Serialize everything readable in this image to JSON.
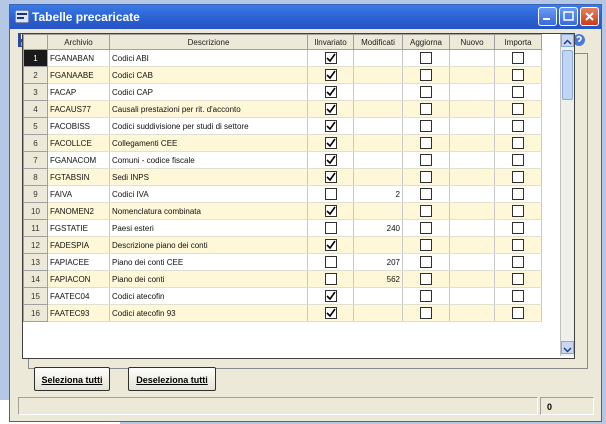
{
  "window": {
    "title": "Tabelle precaricate"
  },
  "columns": [
    "",
    "Archivio",
    "Descrizione",
    "Ilnvariato",
    "Modificati",
    "Aggiorna",
    "Nuovo",
    "Importa"
  ],
  "rows": [
    {
      "n": "1",
      "archivio": "FGANABAN",
      "descrizione": "Codici ABI",
      "invariato": true,
      "modificati": "",
      "aggiorna": false,
      "nuovo": "",
      "importa": false
    },
    {
      "n": "2",
      "archivio": "FGANAABE",
      "descrizione": "Codici CAB",
      "invariato": true,
      "modificati": "",
      "aggiorna": false,
      "nuovo": "",
      "importa": false
    },
    {
      "n": "3",
      "archivio": "FACAP",
      "descrizione": "Codici CAP",
      "invariato": true,
      "modificati": "",
      "aggiorna": false,
      "nuovo": "",
      "importa": false
    },
    {
      "n": "4",
      "archivio": "FACAUS77",
      "descrizione": "Causali prestazioni per rit. d'acconto",
      "invariato": true,
      "modificati": "",
      "aggiorna": false,
      "nuovo": "",
      "importa": false
    },
    {
      "n": "5",
      "archivio": "FACOBISS",
      "descrizione": "Codici suddivisione per studi di settore",
      "invariato": true,
      "modificati": "",
      "aggiorna": false,
      "nuovo": "",
      "importa": false
    },
    {
      "n": "6",
      "archivio": "FACOLLCE",
      "descrizione": "Collegamenti CEE",
      "invariato": true,
      "modificati": "",
      "aggiorna": false,
      "nuovo": "",
      "importa": false
    },
    {
      "n": "7",
      "archivio": "FGANACOM",
      "descrizione": "Comuni - codice fiscale",
      "invariato": true,
      "modificati": "",
      "aggiorna": false,
      "nuovo": "",
      "importa": false
    },
    {
      "n": "8",
      "archivio": "FGTABSIN",
      "descrizione": "Sedi INPS",
      "invariato": true,
      "modificati": "",
      "aggiorna": false,
      "nuovo": "",
      "importa": false
    },
    {
      "n": "9",
      "archivio": "FAIVA",
      "descrizione": "Codici IVA",
      "invariato": false,
      "modificati": "2",
      "aggiorna": false,
      "nuovo": "",
      "importa": false
    },
    {
      "n": "10",
      "archivio": "FANOMEN2",
      "descrizione": "Nomenclatura combinata",
      "invariato": true,
      "modificati": "",
      "aggiorna": false,
      "nuovo": "",
      "importa": false
    },
    {
      "n": "11",
      "archivio": "FGSTATIE",
      "descrizione": "Paesi esteri",
      "invariato": false,
      "modificati": "240",
      "aggiorna": false,
      "nuovo": "",
      "importa": false
    },
    {
      "n": "12",
      "archivio": "FADESPIA",
      "descrizione": "Descrizione piano dei conti",
      "invariato": true,
      "modificati": "",
      "aggiorna": false,
      "nuovo": "",
      "importa": false
    },
    {
      "n": "13",
      "archivio": "FAPIACEE",
      "descrizione": "Piano dei conti CEE",
      "invariato": false,
      "modificati": "207",
      "aggiorna": false,
      "nuovo": "",
      "importa": false
    },
    {
      "n": "14",
      "archivio": "FAPIACON",
      "descrizione": "Piano dei conti",
      "invariato": false,
      "modificati": "562",
      "aggiorna": false,
      "nuovo": "",
      "importa": false
    },
    {
      "n": "15",
      "archivio": "FAATEC04",
      "descrizione": "Codici atecofin",
      "invariato": true,
      "modificati": "",
      "aggiorna": false,
      "nuovo": "",
      "importa": false
    },
    {
      "n": "16",
      "archivio": "FAATEC93",
      "descrizione": "Codici atecofin 93",
      "invariato": true,
      "modificati": "",
      "aggiorna": false,
      "nuovo": "",
      "importa": false
    }
  ],
  "buttons": {
    "select_all": "Seleziona tutti",
    "deselect_all": "Deseleziona tutti"
  },
  "status": {
    "count": "0"
  },
  "colors": {
    "title_bar": "#2a5fd0",
    "row_highlight": "#fff8d8",
    "selected_row_marker": "#1a1a1a"
  },
  "icons": [
    "save-icon",
    "refresh-icon",
    "binoculars-icon",
    "grid-icon",
    "print-icon",
    "help-icon"
  ]
}
